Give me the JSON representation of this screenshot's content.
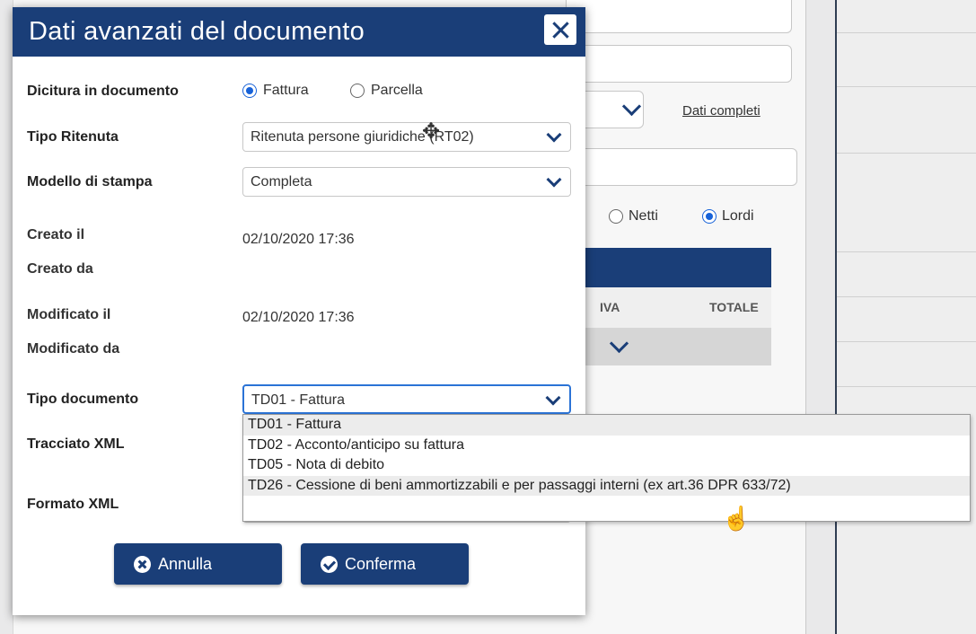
{
  "background": {
    "link_label": "Dati completi",
    "radio_netti": "Netti",
    "radio_lordi": "Lordi",
    "col_iva": "IVA",
    "col_totale": "TOTALE"
  },
  "dialog": {
    "title": "Dati avanzati del documento",
    "fields": {
      "dicitura_label": "Dicitura in documento",
      "dicitura_options": [
        "Fattura",
        "Parcella"
      ],
      "dicitura_selected": "Fattura",
      "tipo_ritenuta_label": "Tipo Ritenuta",
      "tipo_ritenuta_value": "Ritenuta persone giuridiche (RT02)",
      "modello_stampa_label": "Modello di stampa",
      "modello_stampa_value": "Completa",
      "creato_il_label": "Creato il",
      "creato_il_value": "02/10/2020 17:36",
      "creato_da_label": "Creato da",
      "modificato_il_label": "Modificato il",
      "modificato_il_value": "02/10/2020 17:36",
      "modificato_da_label": "Modificato da",
      "tipo_documento_label": "Tipo documento",
      "tipo_documento_value": "TD01 - Fattura",
      "tracciato_xml_label": "Tracciato XML",
      "formato_xml_label": "Formato XML"
    },
    "dropdown_options": [
      "TD01 - Fattura",
      "TD02 - Acconto/anticipo su fattura",
      "TD05 - Nota di debito",
      "TD26 - Cessione di beni ammortizzabili e per passaggi interni (ex art.36 DPR 633/72)"
    ],
    "buttons": {
      "cancel": "Annulla",
      "confirm": "Conferma"
    }
  },
  "colors": {
    "primary": "#1a3e78",
    "radio_accent": "#1762d8"
  }
}
